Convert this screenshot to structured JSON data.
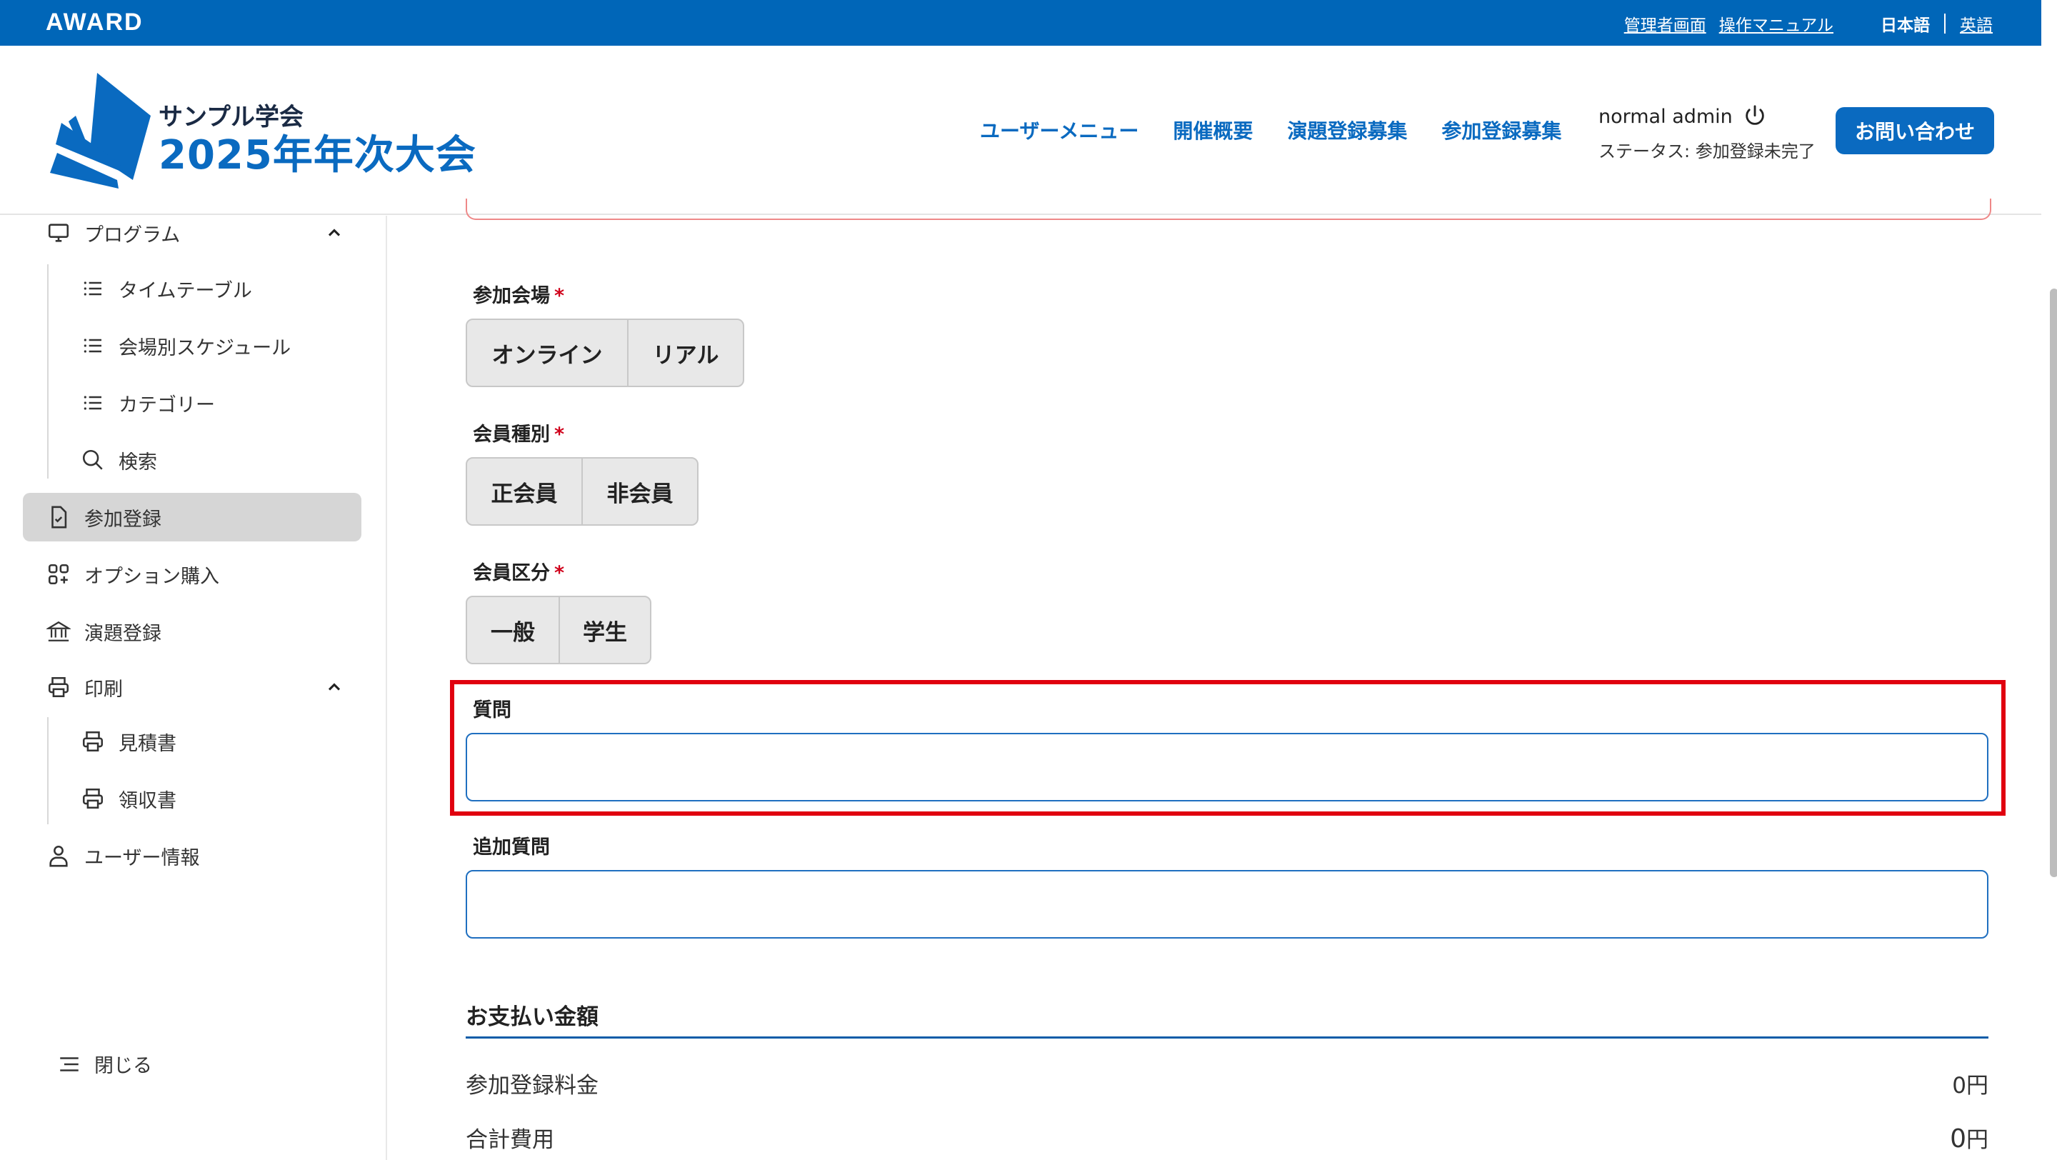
{
  "topbar": {
    "brand": "AWARD",
    "links": {
      "admin": "管理者画面",
      "manual": "操作マニュアル"
    },
    "lang": {
      "ja": "日本語",
      "en": "英語"
    }
  },
  "header": {
    "logo_line1": "サンプル学会",
    "logo_line2": "2025年年次大会",
    "nav": [
      "ユーザーメニュー",
      "開催概要",
      "演題登録募集",
      "参加登録募集"
    ],
    "user_name": "normal admin",
    "status": "ステータス: 参加登録未完了",
    "contact_label": "お問い合わせ"
  },
  "sidebar": {
    "items": [
      {
        "label": "プログラム"
      },
      {
        "label": "タイムテーブル"
      },
      {
        "label": "会場別スケジュール"
      },
      {
        "label": "カテゴリー"
      },
      {
        "label": "検索"
      },
      {
        "label": "参加登録"
      },
      {
        "label": "オプション購入"
      },
      {
        "label": "演題登録"
      },
      {
        "label": "印刷"
      },
      {
        "label": "見積書"
      },
      {
        "label": "領収書"
      },
      {
        "label": "ユーザー情報"
      }
    ],
    "close_label": "閉じる"
  },
  "form": {
    "venue": {
      "label": "参加会場",
      "required": "*",
      "options": [
        "オンライン",
        "リアル"
      ]
    },
    "member_type": {
      "label": "会員種別",
      "required": "*",
      "options": [
        "正会員",
        "非会員"
      ]
    },
    "member_class": {
      "label": "会員区分",
      "required": "*",
      "options": [
        "一般",
        "学生"
      ]
    },
    "question": {
      "label": "質問",
      "value": ""
    },
    "extra_question": {
      "label": "追加質問",
      "value": ""
    }
  },
  "payment": {
    "title": "お支払い金額",
    "rows": [
      {
        "label": "参加登録料金",
        "amount": "0",
        "unit": "円"
      },
      {
        "label": "合計費用",
        "amount": "0",
        "unit": "円"
      }
    ]
  },
  "colors": {
    "primary": "#0a6ac0",
    "topbar": "#0066b8",
    "highlight": "#e0000f",
    "required": "#d0021b"
  }
}
